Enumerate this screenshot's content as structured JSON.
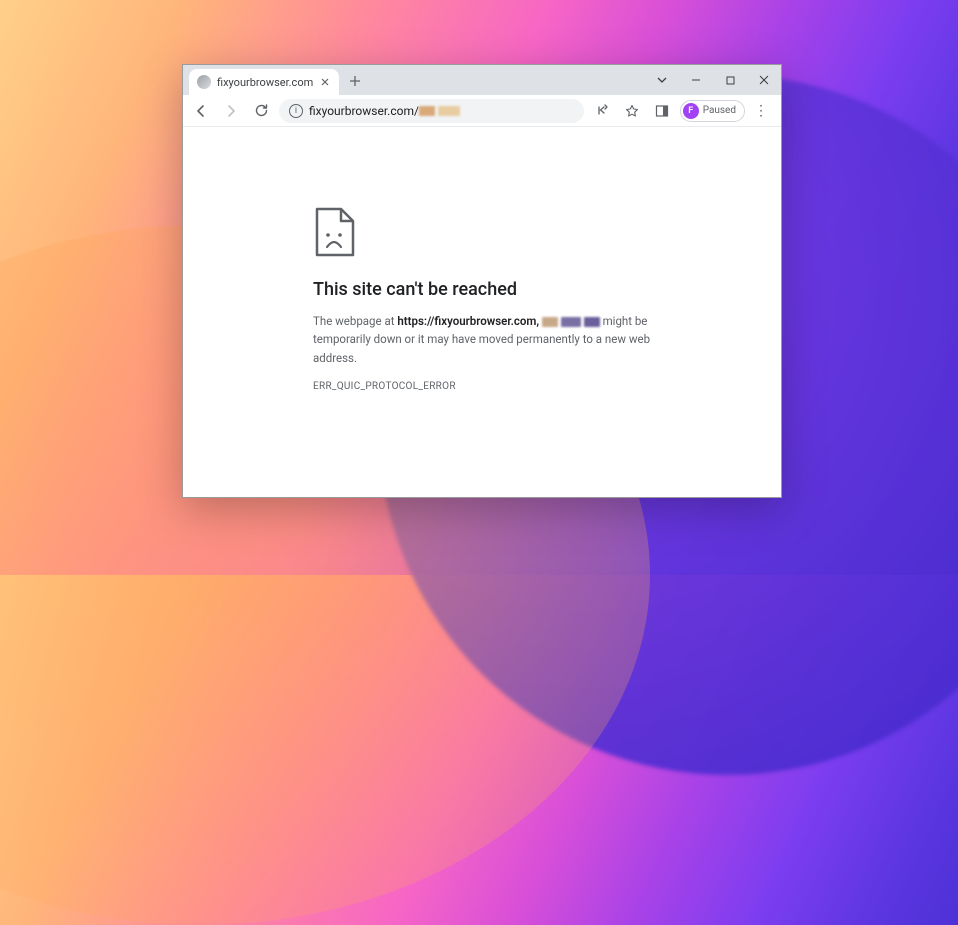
{
  "tab": {
    "title": "fixyourbrowser.com"
  },
  "toolbar": {
    "url_display": "fixyourbrowser.com/"
  },
  "profile": {
    "initial": "F",
    "status": "Paused"
  },
  "error": {
    "heading": "This site can't be reached",
    "body_prefix": "The webpage at ",
    "body_url": "https://fixyourbrowser.com",
    "body_suffix": " might be temporarily down or it may have moved permanently to a new web address.",
    "code": "ERR_QUIC_PROTOCOL_ERROR"
  }
}
